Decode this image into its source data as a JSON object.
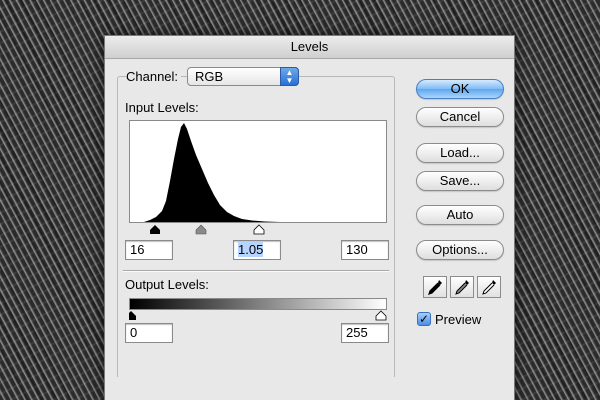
{
  "window": {
    "title": "Levels"
  },
  "channel": {
    "label": "Channel:",
    "value": "RGB"
  },
  "input_levels": {
    "label": "Input Levels:",
    "black": "16",
    "gamma": "1.05",
    "white": "130"
  },
  "output_levels": {
    "label": "Output Levels:",
    "black": "0",
    "white": "255"
  },
  "buttons": {
    "ok": "OK",
    "cancel": "Cancel",
    "load": "Load...",
    "save": "Save...",
    "auto": "Auto",
    "options": "Options..."
  },
  "preview": {
    "label": "Preview",
    "checked": true
  },
  "icons": {
    "black_eyedropper": "eyedropper-black-icon",
    "gray_eyedropper": "eyedropper-gray-icon",
    "white_eyedropper": "eyedropper-white-icon"
  },
  "colors": {
    "default_button": "#5ea6f0",
    "checkbox": "#4a8ee6"
  }
}
